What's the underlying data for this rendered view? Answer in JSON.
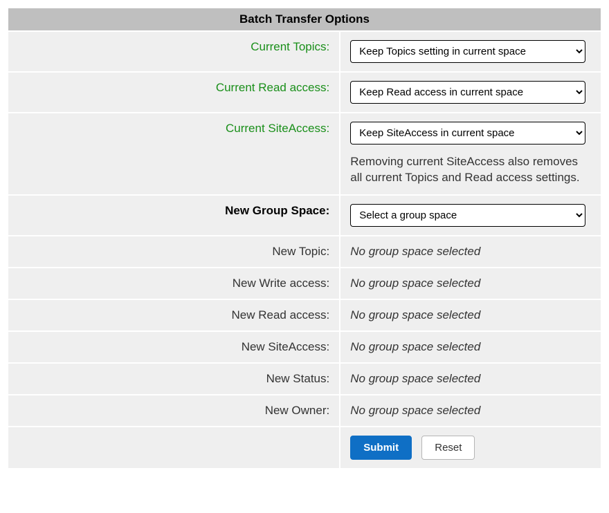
{
  "header": "Batch Transfer Options",
  "rows": {
    "current_topics": {
      "label": "Current Topics:",
      "select_value": "Keep Topics setting in current space"
    },
    "current_read": {
      "label": "Current Read access:",
      "select_value": "Keep Read access in current space"
    },
    "current_siteaccess": {
      "label": "Current SiteAccess:",
      "select_value": "Keep SiteAccess in current space",
      "help": "Removing current SiteAccess also removes all current Topics and Read access settings."
    },
    "new_group_space": {
      "label": "New Group Space:",
      "select_value": "Select a group space"
    },
    "new_topic": {
      "label": "New Topic:",
      "value": "No group space selected"
    },
    "new_write": {
      "label": "New Write access:",
      "value": "No group space selected"
    },
    "new_read": {
      "label": "New Read access:",
      "value": "No group space selected"
    },
    "new_siteaccess": {
      "label": "New SiteAccess:",
      "value": "No group space selected"
    },
    "new_status": {
      "label": "New Status:",
      "value": "No group space selected"
    },
    "new_owner": {
      "label": "New Owner:",
      "value": "No group space selected"
    }
  },
  "buttons": {
    "submit": "Submit",
    "reset": "Reset"
  }
}
